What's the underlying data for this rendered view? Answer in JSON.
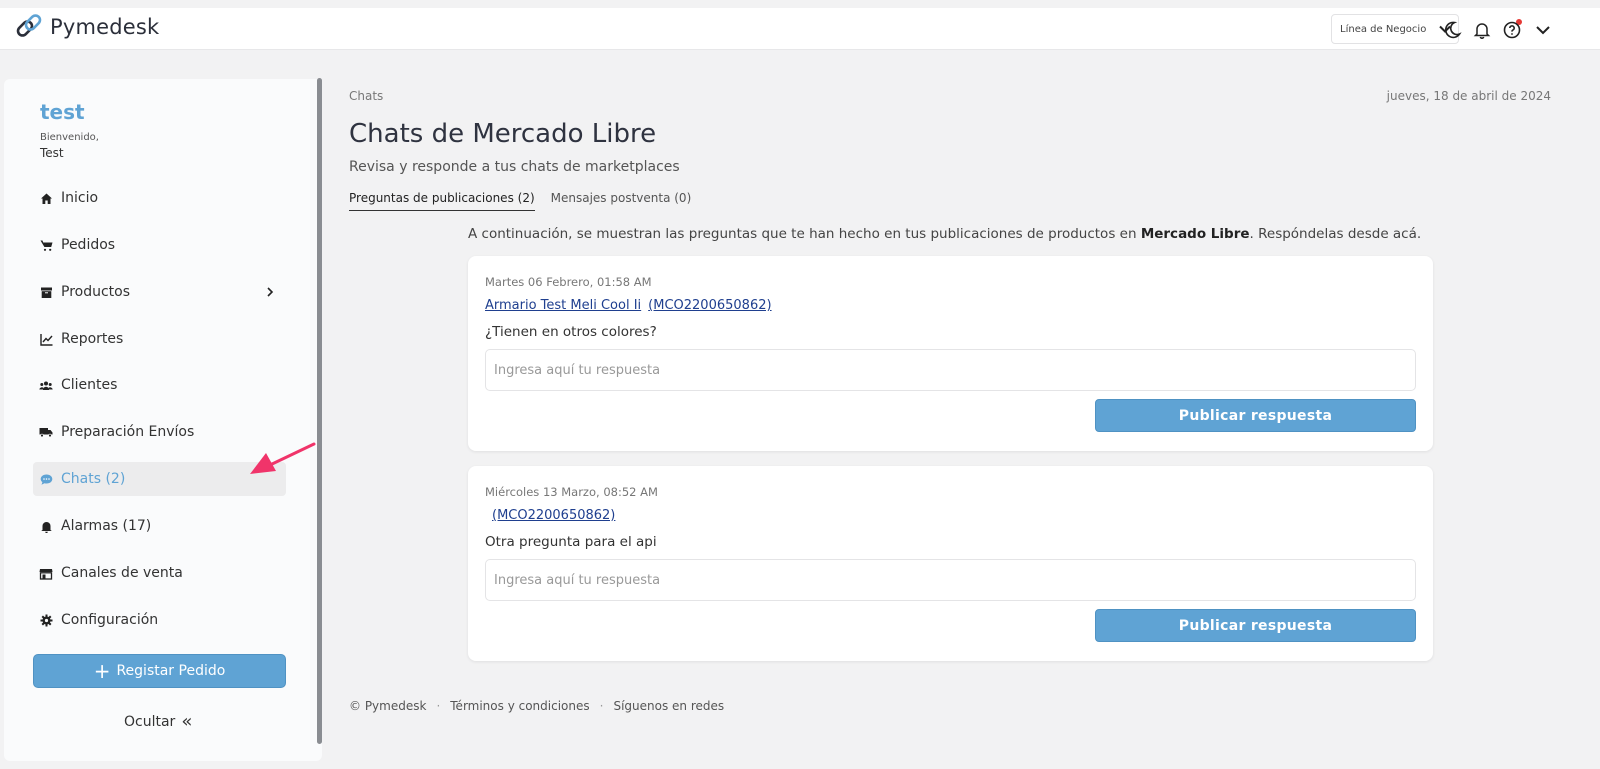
{
  "header": {
    "brand": "Pymedesk",
    "business_line_label": "Línea de Negocio"
  },
  "sidebar": {
    "user_name": "test",
    "welcome": "Bienvenido,",
    "user_display": "Test",
    "items": [
      {
        "label": "Inicio",
        "icon": "home-icon"
      },
      {
        "label": "Pedidos",
        "icon": "cart-icon"
      },
      {
        "label": "Productos",
        "icon": "box-icon"
      },
      {
        "label": "Reportes",
        "icon": "chart-line-icon"
      },
      {
        "label": "Clientes",
        "icon": "users-icon"
      },
      {
        "label": "Preparación Envíos",
        "icon": "truck-icon"
      },
      {
        "label": "Chats (2)",
        "icon": "chat-icon"
      },
      {
        "label": "Alarmas (17)",
        "icon": "bell-icon"
      },
      {
        "label": "Canales de venta",
        "icon": "store-icon"
      },
      {
        "label": "Configuración",
        "icon": "gear-icon"
      }
    ],
    "register_label": "Registar Pedido",
    "hide_label": "Ocultar"
  },
  "main": {
    "breadcrumb": "Chats",
    "date": "jueves, 18 de abril de 2024",
    "title": "Chats de Mercado Libre",
    "subtitle": "Revisa y responde a tus chats de marketplaces",
    "tabs": [
      {
        "label": "Preguntas de publicaciones (2)",
        "active": true
      },
      {
        "label": "Mensajes postventa (0)",
        "active": false
      }
    ],
    "intro_prefix": "A continuación, se muestran las preguntas que te han hecho en tus publicaciones de productos en ",
    "intro_bold": "Mercado Libre",
    "intro_suffix": ". Respóndelas desde acá.",
    "questions": [
      {
        "date": "Martes 06 Febrero, 01:58 AM",
        "product": "Armario Test Meli Cool Ii",
        "code": "(MCO2200650862)",
        "question": "¿Tienen en otros colores?",
        "placeholder": "Ingresa aquí tu respuesta",
        "button": "Publicar respuesta"
      },
      {
        "date": "Miércoles 13 Marzo, 08:52 AM",
        "product": "",
        "code": "(MCO2200650862)",
        "question": "Otra pregunta para el api",
        "placeholder": "Ingresa aquí tu respuesta",
        "button": "Publicar respuesta"
      }
    ]
  },
  "footer": {
    "copyright": "© Pymedesk",
    "terms": "Términos y condiciones",
    "social": "Síguenos en redes",
    "separator": "·"
  },
  "colors": {
    "accent": "#5fa3d4",
    "link": "#1f3f8f",
    "arrow": "#f0346a",
    "notification": "#e53935"
  }
}
